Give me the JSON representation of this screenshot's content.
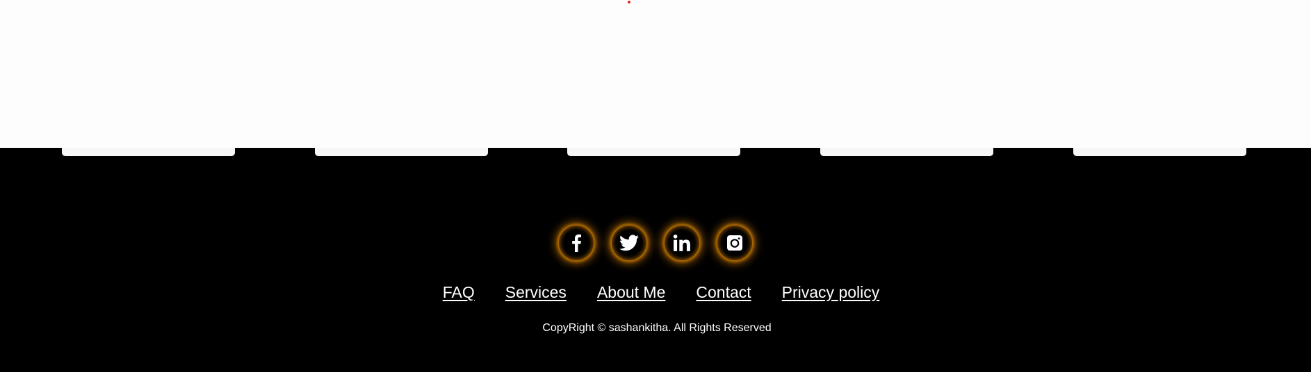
{
  "colors": {
    "footer_bg": "#000000",
    "page_bg": "#fdfdfd",
    "glow": "#ff9600",
    "link": "#ffffff"
  },
  "social_icons": [
    {
      "icon": "facebook-icon"
    },
    {
      "icon": "twitter-icon"
    },
    {
      "icon": "linkedin-icon"
    },
    {
      "icon": "instagram-icon"
    }
  ],
  "footer": {
    "links": [
      "FAQ",
      "Services",
      "About Me",
      "Contact",
      "Privacy policy"
    ],
    "copyright": "CopyRight © sashankitha. All Rights Reserved"
  }
}
